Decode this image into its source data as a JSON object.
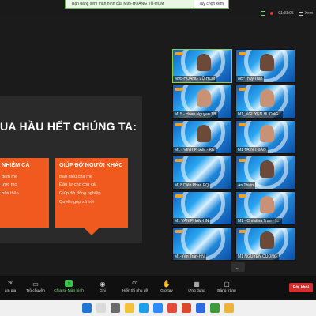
{
  "banner": {
    "message": "Bạn đang xem màn hình của M95-HOÀNG VŨ-HCM",
    "view_options": "Tùy chọn xem"
  },
  "topbar": {
    "timer": "01:31:05",
    "view_label": "Xem"
  },
  "slide": {
    "heading": "UA HẦU HẾT CHÚNG TA:",
    "left_card": {
      "title": "NHIỆM CẢ",
      "items": [
        "đam mê",
        "ước mơ",
        "bản thân"
      ]
    },
    "right_card": {
      "title": "GIÚP ĐỠ NGƯỜI KHÁC",
      "items": [
        "Báo hiếu cha mẹ",
        "Đầu tư cho con cái",
        "Giúp đỡ đồng nghiệp",
        "Quyên góp xã hội"
      ]
    }
  },
  "participants": [
    {
      "name": "M95-HOÀNG VŨ-HCM",
      "active": true
    },
    {
      "name": "M5*Thuy Tran"
    },
    {
      "name": "M15 - Hoan Nguyen.TB"
    },
    {
      "name": "M1_NGUYEN HUONG..."
    },
    {
      "name": "M1 - VINH PHAM - Kh"
    },
    {
      "name": "M1 TRINH ĐÀO"
    },
    {
      "name": "M18 Diên Phan.PQ"
    },
    {
      "name": "An Thiên"
    },
    {
      "name": "M1 VÂN PHẠM-HN"
    },
    {
      "name": "M1 - Christina Tran - 1..."
    },
    {
      "name": "M1-Yến Trần-HN"
    },
    {
      "name": "M1 NGUYEN CUONG"
    }
  ],
  "controls": {
    "participants_count": "2K",
    "join": "am gia",
    "chat": "Trò chuyện",
    "share": "Chia sẻ Màn hình",
    "record": "Ghi",
    "captions": "Hiển thị phụ đề",
    "reactions": "Giơ tay",
    "apps": "Ứng dụng",
    "whiteboards": "Bảng trắng",
    "leave": "Rời khỏi"
  },
  "colors": {
    "accent": "#f05a1f",
    "share_green": "#2dcc4a",
    "leave_red": "#d92d2d"
  }
}
